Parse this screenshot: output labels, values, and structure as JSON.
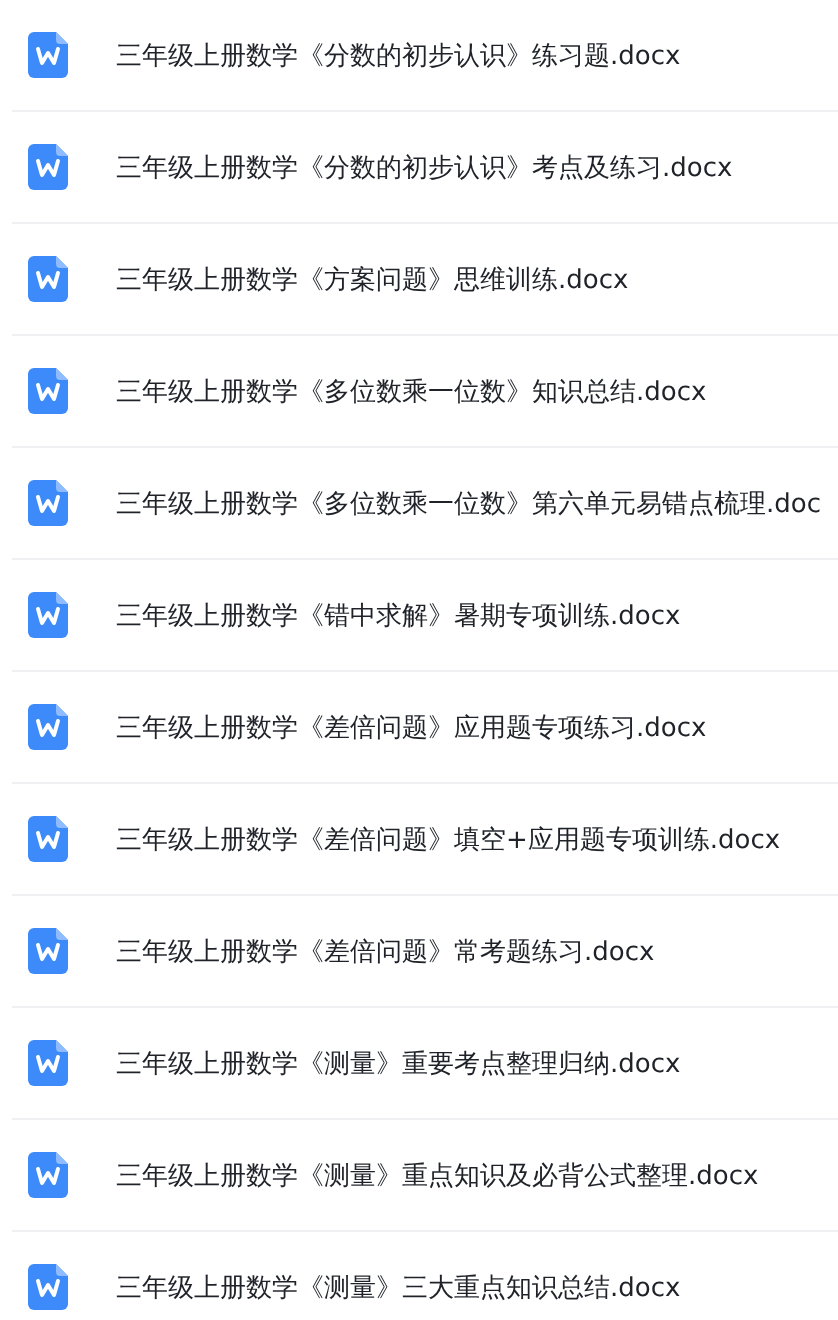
{
  "files": [
    {
      "name": "三年级上册数学《分数的初步认识》练习题.docx"
    },
    {
      "name": "三年级上册数学《分数的初步认识》考点及练习.docx"
    },
    {
      "name": "三年级上册数学《方案问题》思维训练.docx"
    },
    {
      "name": "三年级上册数学《多位数乘一位数》知识总结.docx"
    },
    {
      "name": "三年级上册数学《多位数乘一位数》第六单元易错点梳理.doc"
    },
    {
      "name": "三年级上册数学《错中求解》暑期专项训练.docx"
    },
    {
      "name": "三年级上册数学《差倍问题》应用题专项练习.docx"
    },
    {
      "name": "三年级上册数学《差倍问题》填空+应用题专项训练.docx"
    },
    {
      "name": "三年级上册数学《差倍问题》常考题练习.docx"
    },
    {
      "name": "三年级上册数学《测量》重要考点整理归纳.docx"
    },
    {
      "name": "三年级上册数学《测量》重点知识及必背公式整理.docx"
    },
    {
      "name": "三年级上册数学《测量》三大重点知识总结.docx"
    }
  ]
}
